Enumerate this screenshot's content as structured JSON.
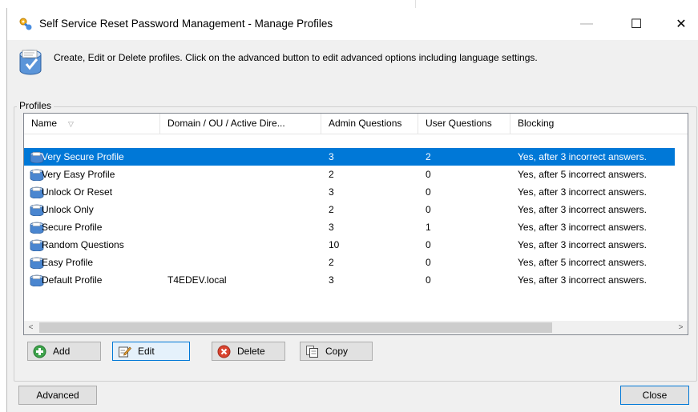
{
  "window": {
    "title": "Self Service Reset Password Management - Manage Profiles",
    "controls": {
      "minimize": "—",
      "maximize": "☐",
      "close": "✕"
    }
  },
  "header": {
    "description": "Create, Edit or Delete profiles. Click on the advanced button to edit advanced options including language settings."
  },
  "profiles": {
    "group_label": "Profiles",
    "columns": [
      "Name",
      "Domain / OU / Active Dire...",
      "Admin Questions",
      "User Questions",
      "Blocking"
    ],
    "rows": [
      {
        "name": "Very Secure Profile",
        "domain": "",
        "admin_questions": "3",
        "user_questions": "2",
        "blocking": "Yes, after 3 incorrect answers.",
        "selected": true
      },
      {
        "name": "Very Easy Profile",
        "domain": "",
        "admin_questions": "2",
        "user_questions": "0",
        "blocking": "Yes, after 5 incorrect answers."
      },
      {
        "name": "Unlock Or Reset",
        "domain": "",
        "admin_questions": "3",
        "user_questions": "0",
        "blocking": "Yes, after 3 incorrect answers."
      },
      {
        "name": "Unlock Only",
        "domain": "",
        "admin_questions": "2",
        "user_questions": "0",
        "blocking": "Yes, after 3 incorrect answers."
      },
      {
        "name": "Secure Profile",
        "domain": "",
        "admin_questions": "3",
        "user_questions": "1",
        "blocking": "Yes, after 3 incorrect answers."
      },
      {
        "name": "Random Questions",
        "domain": "",
        "admin_questions": "10",
        "user_questions": "0",
        "blocking": "Yes, after 3 incorrect answers."
      },
      {
        "name": "Easy Profile",
        "domain": "",
        "admin_questions": "2",
        "user_questions": "0",
        "blocking": "Yes, after 5 incorrect answers."
      },
      {
        "name": "Default Profile",
        "domain": "T4EDEV.local",
        "admin_questions": "3",
        "user_questions": "0",
        "blocking": "Yes, after 3 incorrect answers."
      }
    ],
    "sort_glyph": "▽",
    "scroll_left": "<",
    "scroll_right": ">"
  },
  "actions": {
    "add": "Add",
    "edit": "Edit",
    "delete": "Delete",
    "copy": "Copy"
  },
  "footer": {
    "advanced": "Advanced",
    "close": "Close"
  },
  "colors": {
    "selection": "#0078d7",
    "window_bg": "#f0f0f0"
  }
}
